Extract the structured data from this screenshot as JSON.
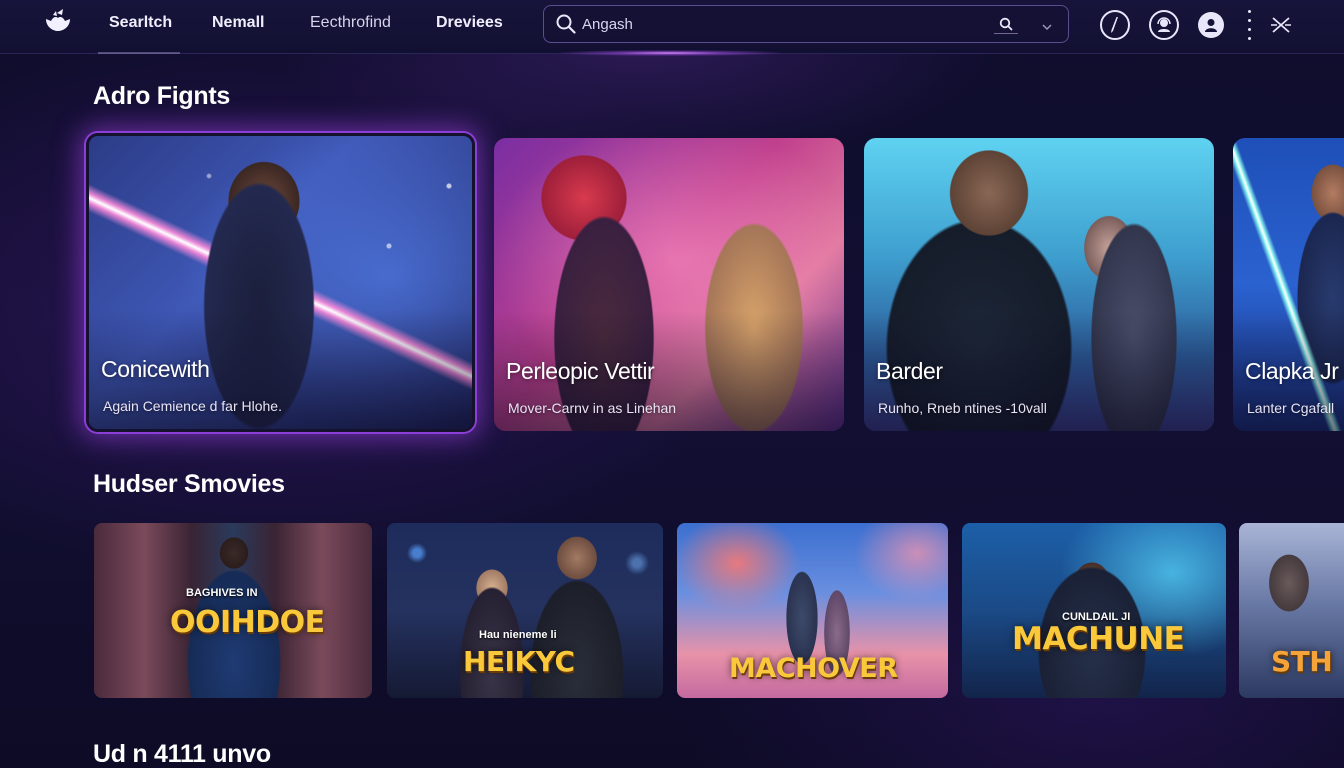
{
  "nav": {
    "items": [
      {
        "label": "Searltch"
      },
      {
        "label": "Nemall"
      },
      {
        "label": "Eecthrofind"
      },
      {
        "label": "Dreviees"
      }
    ]
  },
  "search": {
    "value": "Angash",
    "placeholder": "Angash"
  },
  "sections": {
    "featured": {
      "title": "Adro Fignts",
      "cards": [
        {
          "title": "Conicewith",
          "subtitle": "Again Cemience d far Hlohe.",
          "active": true
        },
        {
          "title": "Perleopic Vettir",
          "subtitle": "Mover-Carnv in as Linehan"
        },
        {
          "title": "Barder",
          "subtitle": "Runho, Rneb ntines -10vall"
        },
        {
          "title": "Clapka Jr",
          "subtitle": "Lanter Cgafall"
        }
      ]
    },
    "movies": {
      "title": "Hudser Smovies",
      "posters": [
        {
          "kicker": "BAGHIVES IN",
          "title": "OOIHDOE"
        },
        {
          "kicker": "Hau nieneme li",
          "title": "HEIKYC"
        },
        {
          "kicker": "",
          "title": "MACHOVER"
        },
        {
          "kicker": "CUNLDAIL JI",
          "title": "MACHUNE"
        },
        {
          "kicker": "",
          "title": "STH"
        }
      ]
    },
    "next": {
      "title": "Ud n 4111 unvo"
    }
  },
  "icons": {
    "logo": "logo-icon",
    "search": "search-icon",
    "chevron": "chevron-down-icon",
    "top_right": [
      "edit-icon",
      "headset-icon",
      "profile-icon",
      "more-icon",
      "close-icon"
    ]
  },
  "colors": {
    "background": "#0f0d2c",
    "accent_glow": "#a94ff0",
    "poster_title": "#f9c93b"
  }
}
